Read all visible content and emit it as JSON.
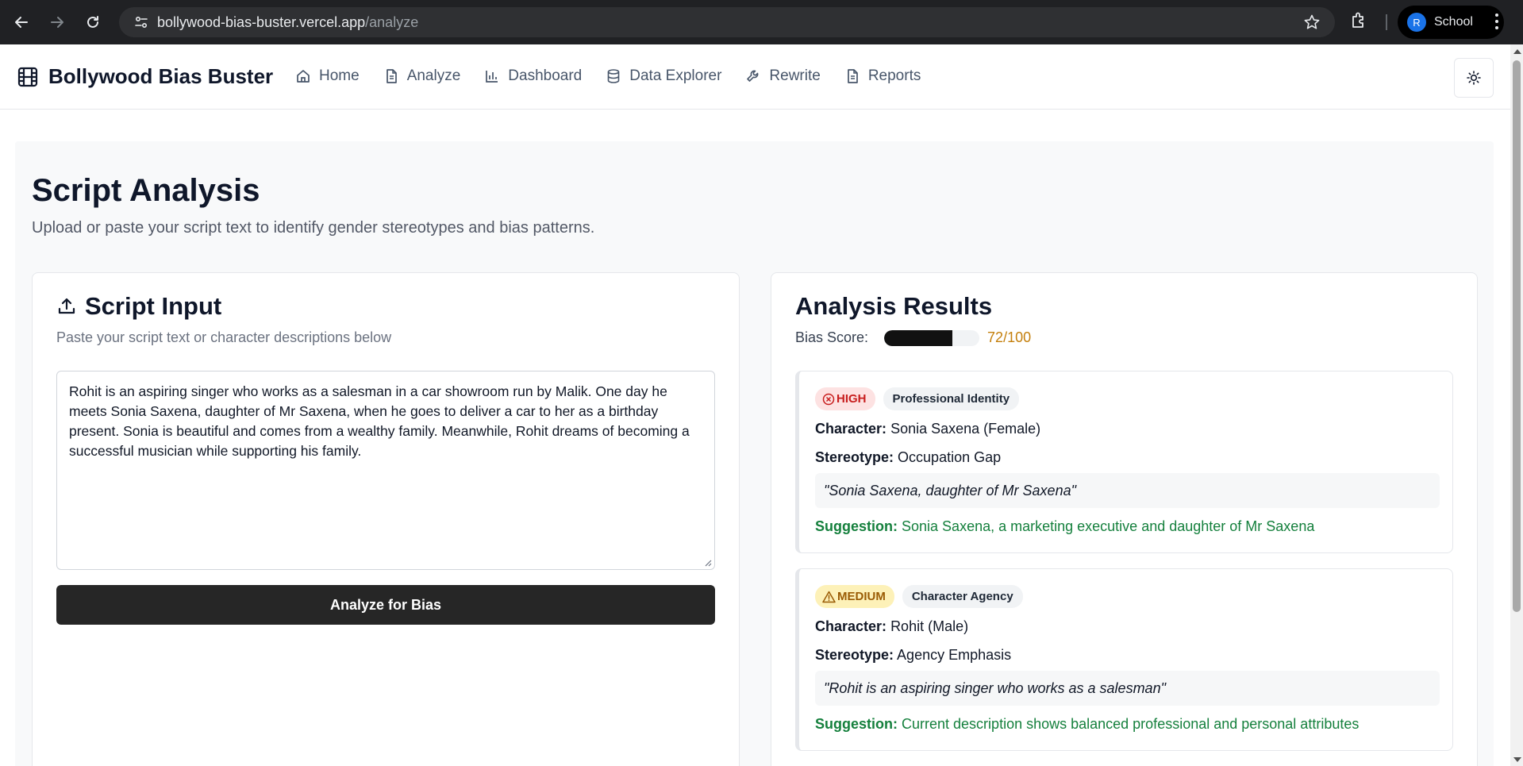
{
  "browser": {
    "url_domain": "bollywood-bias-buster.vercel.app",
    "url_path": "/analyze",
    "profile_initial": "R",
    "profile_label": "School"
  },
  "header": {
    "brand": "Bollywood Bias Buster",
    "nav": [
      {
        "label": "Home",
        "icon": "home-icon"
      },
      {
        "label": "Analyze",
        "icon": "file-text-icon"
      },
      {
        "label": "Dashboard",
        "icon": "bar-chart-icon"
      },
      {
        "label": "Data Explorer",
        "icon": "database-icon"
      },
      {
        "label": "Rewrite",
        "icon": "wrench-icon"
      },
      {
        "label": "Reports",
        "icon": "file-text-icon"
      }
    ],
    "theme_icon": "sun-icon"
  },
  "page": {
    "title": "Script Analysis",
    "subtitle": "Upload or paste your script text to identify gender stereotypes and bias patterns."
  },
  "input_card": {
    "title": "Script Input",
    "description": "Paste your script text or character descriptions below",
    "script_text": "Rohit is an aspiring singer who works as a salesman in a car showroom run by Malik. One day he meets Sonia Saxena, daughter of Mr Saxena, when he goes to deliver a car to her as a birthday present. Sonia is beautiful and comes from a wealthy family. Meanwhile, Rohit dreams of becoming a successful musician while supporting his family.",
    "button_label": "Analyze for Bias"
  },
  "results": {
    "title": "Analysis Results",
    "score_label": "Bias Score:",
    "score_value": 72,
    "score_text": "72/100",
    "score_color": "#c47f0c",
    "findings": [
      {
        "severity": "HIGH",
        "severity_icon": "x-circle-icon",
        "category": "Professional Identity",
        "character_label": "Character:",
        "character": "Sonia Saxena (Female)",
        "stereotype_label": "Stereotype:",
        "stereotype": "Occupation Gap",
        "quote": "\"Sonia Saxena, daughter of Mr Saxena\"",
        "suggestion_label": "Suggestion:",
        "suggestion": "Sonia Saxena, a marketing executive and daughter of Mr Saxena"
      },
      {
        "severity": "MEDIUM",
        "severity_icon": "alert-triangle-icon",
        "category": "Character Agency",
        "character_label": "Character:",
        "character": "Rohit (Male)",
        "stereotype_label": "Stereotype:",
        "stereotype": "Agency Emphasis",
        "quote": "\"Rohit is an aspiring singer who works as a salesman\"",
        "suggestion_label": "Suggestion:",
        "suggestion": "Current description shows balanced professional and personal attributes"
      }
    ]
  },
  "colors": {
    "high_bg": "#fde2e2",
    "high_text": "#c81e1e",
    "medium_bg": "#fdf1b8",
    "medium_text": "#9a5b04",
    "suggestion": "#15803d",
    "button": "#262626"
  }
}
